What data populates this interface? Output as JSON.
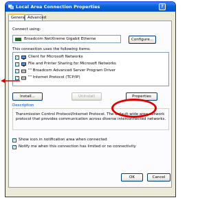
{
  "window": {
    "title": "Local Area Connection Properties",
    "help_label": "?"
  },
  "tabs": [
    {
      "label": "General"
    },
    {
      "label": "Advanced"
    }
  ],
  "connect_using": {
    "label": "Connect using:",
    "adapter": "Broadcom NetXtreme Gigabit Etherne",
    "configure_label": "Configure..."
  },
  "items_section": {
    "label": "This connection uses the following items:",
    "items": [
      {
        "label": "Client for Microsoft Networks",
        "checked": true
      },
      {
        "label": "File and Printer Sharing for Microsoft Networks",
        "checked": true
      },
      {
        "label": "\"\" Broadcom Advanced Server Program Driver",
        "checked": true
      },
      {
        "label": "\"\" Internet Protocol (TCP/IP)",
        "checked": true
      }
    ]
  },
  "buttons": {
    "install": "Install...",
    "uninstall": "Uninstall",
    "properties": "Properties"
  },
  "description": {
    "label": "Description",
    "text": "Transmission Control Protocol/Internet Protocol. The default wide area network protocol that provides communication across diverse interconnected networks."
  },
  "options": [
    {
      "label": "Show icon in notification area when connected",
      "checked": true
    },
    {
      "label": "Notify me when this connection has limited or no connectivity",
      "checked": true
    }
  ],
  "dialog_buttons": {
    "ok": "OK",
    "cancel": "Cancel"
  },
  "colors": {
    "annotation": "#e00000",
    "titlebar": "#0a5fd8"
  },
  "icons": {
    "window": "network-icon",
    "adapter": "network-card-icon"
  }
}
